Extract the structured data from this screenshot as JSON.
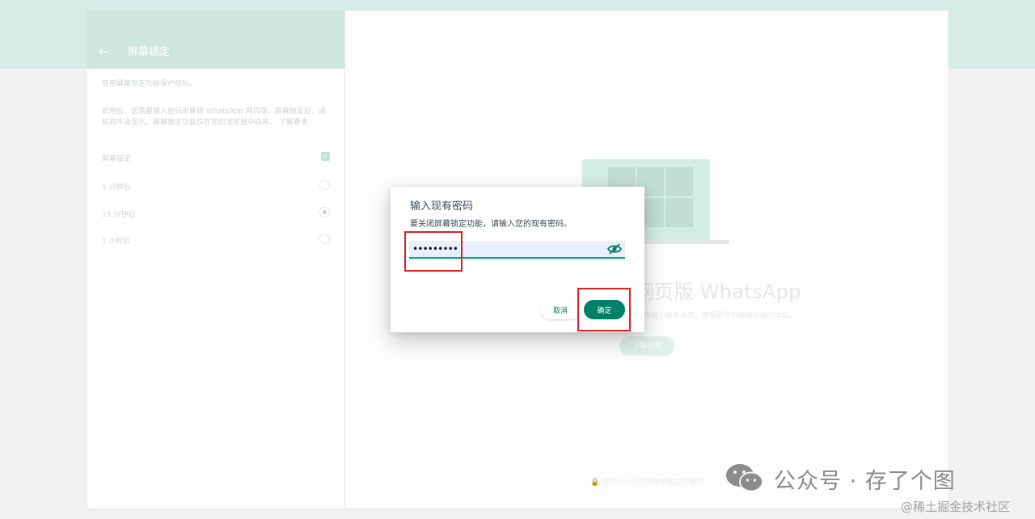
{
  "left_panel": {
    "title": "屏幕锁定",
    "desc1": "使用屏幕锁定功能保护隐私。",
    "desc2": "启用后，您需要输入密码来解锁 WhatsApp 网页版。屏幕锁定后，通知将不会显示。屏幕锁定功能仅在您的浏览器中启用。 了解更多",
    "options": [
      {
        "label": "屏幕锁定",
        "control": "checkbox",
        "checked": true
      },
      {
        "label": "1 分钟后",
        "control": "radio",
        "checked": false
      },
      {
        "label": "15 分钟后",
        "control": "radio",
        "checked": true
      },
      {
        "label": "1 小时后",
        "control": "radio",
        "checked": false
      }
    ]
  },
  "background": {
    "title": "网页版 WhatsApp",
    "subtitle": "在电脑上收发消息，享受更佳的通话和聊天体验。",
    "button": "下载应用",
    "footer": "🔒 您的个人消息受端到端加密保护"
  },
  "dialog": {
    "title": "输入现有密码",
    "description": "要关闭屏幕锁定功能，请输入您的现有密码。",
    "password_value": "•••••••••",
    "cancel_label": "取消",
    "confirm_label": "确定"
  },
  "watermark": {
    "text": "公众号 · 存了个图",
    "sub": "@稀土掘金技术社区"
  },
  "colors": {
    "accent": "#00a884",
    "button_primary": "#008069",
    "annotation": "#e02020",
    "header_bg": "#d6ece6",
    "input_bg": "#e8f0fe"
  },
  "icons": {
    "back": "arrow-left-icon",
    "eye": "eye-off-icon",
    "wechat": "wechat-icon"
  }
}
